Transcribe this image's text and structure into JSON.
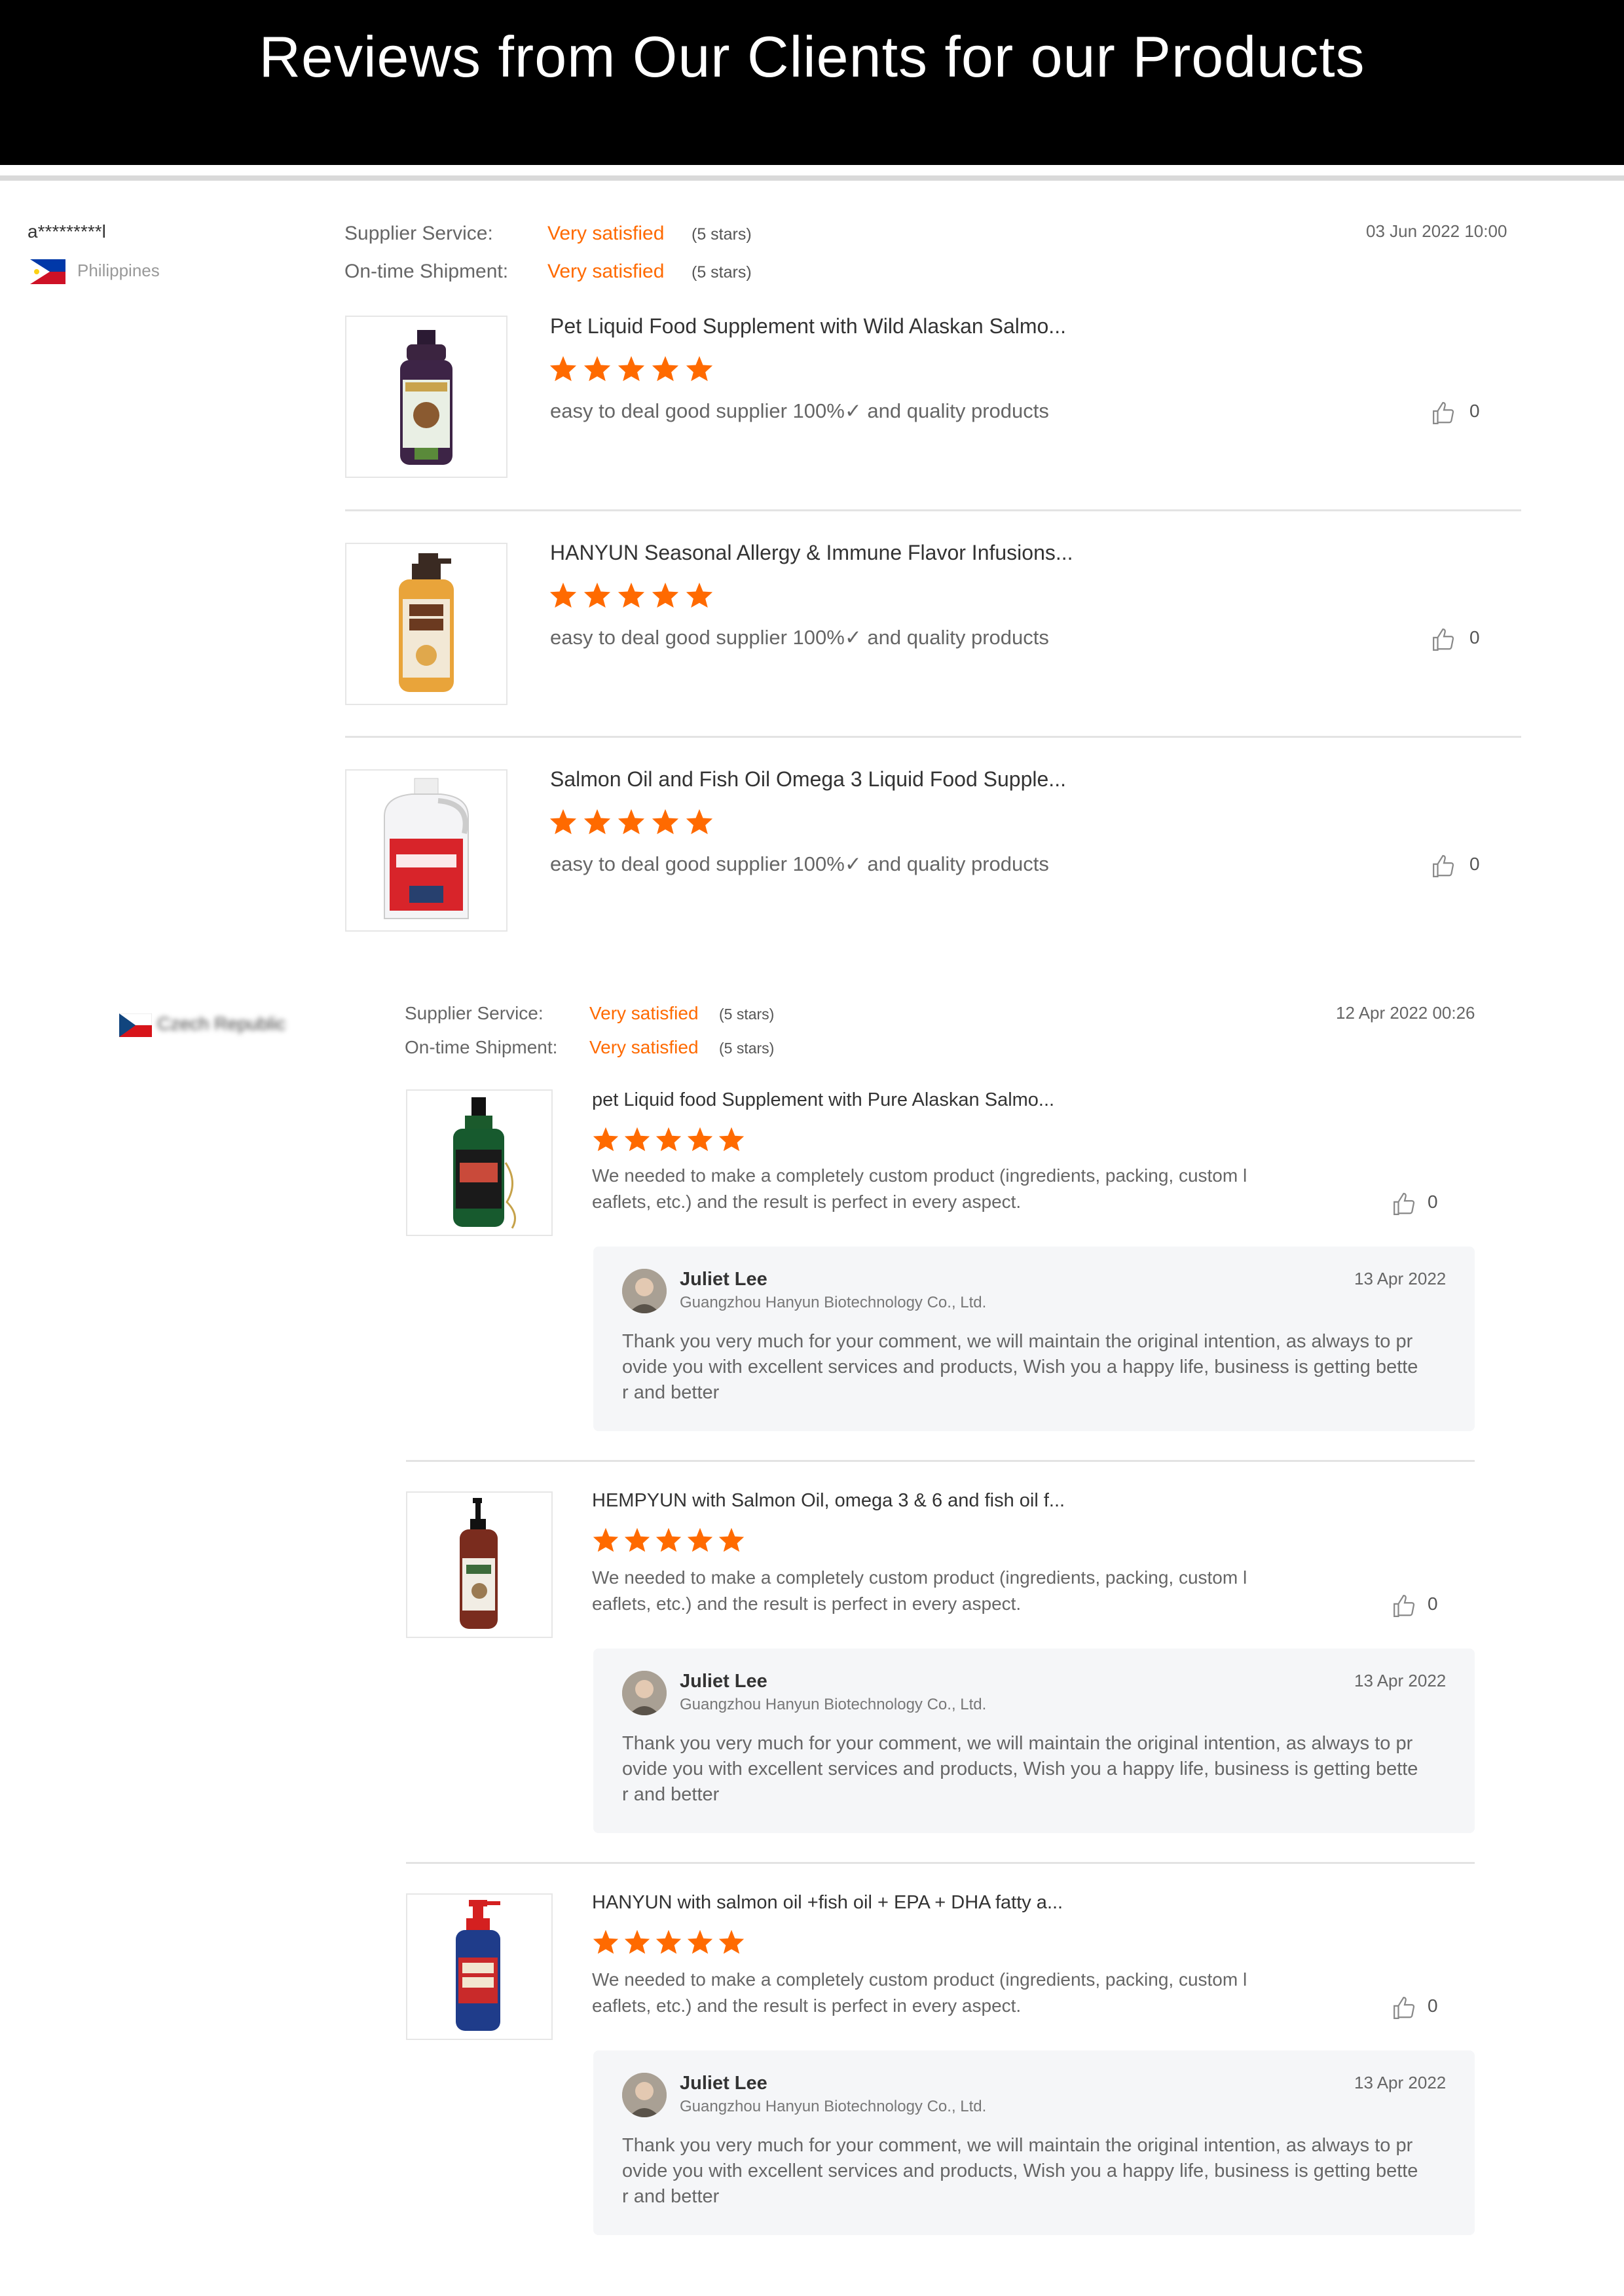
{
  "header": {
    "title": "Reviews from Our Clients for our Products"
  },
  "colors": {
    "accent": "#ff6a00",
    "header_bg": "#000000"
  },
  "review1": {
    "reviewer": "a*********l",
    "country": "Philippines",
    "supplier_service_label": "Supplier Service:",
    "supplier_service_value": "Very satisfied",
    "supplier_service_stars": "(5 stars)",
    "shipment_label": "On-time Shipment:",
    "shipment_value": "Very satisfied",
    "shipment_stars": "(5 stars)",
    "date": "03 Jun 2022 10:00",
    "items": [
      {
        "title": "Pet Liquid Food Supplement with Wild Alaskan Salmo...",
        "rating": 5,
        "text": "easy to deal good supplier 100%✓ and quality products",
        "likes": "0"
      },
      {
        "title": "HANYUN Seasonal Allergy & Immune Flavor Infusions...",
        "rating": 5,
        "text": "easy to deal good supplier 100%✓ and quality products",
        "likes": "0"
      },
      {
        "title": "Salmon Oil and Fish Oil Omega 3 Liquid Food Supple...",
        "rating": 5,
        "text": "easy to deal good supplier 100%✓ and quality products",
        "likes": "0"
      }
    ]
  },
  "review2": {
    "country": "Czech Republic",
    "supplier_service_label": "Supplier Service:",
    "supplier_service_value": "Very satisfied",
    "supplier_service_stars": "(5 stars)",
    "shipment_label": "On-time Shipment:",
    "shipment_value": "Very satisfied",
    "shipment_stars": "(5 stars)",
    "date": "12 Apr 2022 00:26",
    "items": [
      {
        "title": "pet Liquid food Supplement with Pure Alaskan Salmo...",
        "rating": 5,
        "text": "We needed to make a completely custom product (ingredients, packing, custom l\neaflets, etc.) and the result is perfect in every aspect.",
        "likes": "0",
        "reply": {
          "name": "Juliet Lee",
          "company": "Guangzhou Hanyun Biotechnology Co., Ltd.",
          "date": "13 Apr 2022",
          "text": "Thank you very much for your comment, we will maintain the original intention, as always to pr\novide you with excellent services and products, Wish you a happy life, business is getting bette\nr and better"
        }
      },
      {
        "title": "HEMPYUN with Salmon Oil, omega 3 & 6 and fish oil f...",
        "rating": 5,
        "text": "We needed to make a completely custom product (ingredients, packing, custom l\neaflets, etc.) and the result is perfect in every aspect.",
        "likes": "0",
        "reply": {
          "name": "Juliet Lee",
          "company": "Guangzhou Hanyun Biotechnology Co., Ltd.",
          "date": "13 Apr 2022",
          "text": "Thank you very much for your comment, we will maintain the original intention, as always to pr\novide you with excellent services and products, Wish you a happy life, business is getting bette\nr and better"
        }
      },
      {
        "title": "HANYUN with salmon oil +fish oil + EPA + DHA fatty a...",
        "rating": 5,
        "text": "We needed to make a completely custom product (ingredients, packing, custom l\neaflets, etc.) and the result is perfect in every aspect.",
        "likes": "0",
        "reply": {
          "name": "Juliet Lee",
          "company": "Guangzhou Hanyun Biotechnology Co., Ltd.",
          "date": "13 Apr 2022",
          "text": "Thank you very much for your comment, we will maintain the original intention, as always to pr\novide you with excellent services and products, Wish you a happy life, business is getting bette\nr and better"
        }
      }
    ]
  }
}
